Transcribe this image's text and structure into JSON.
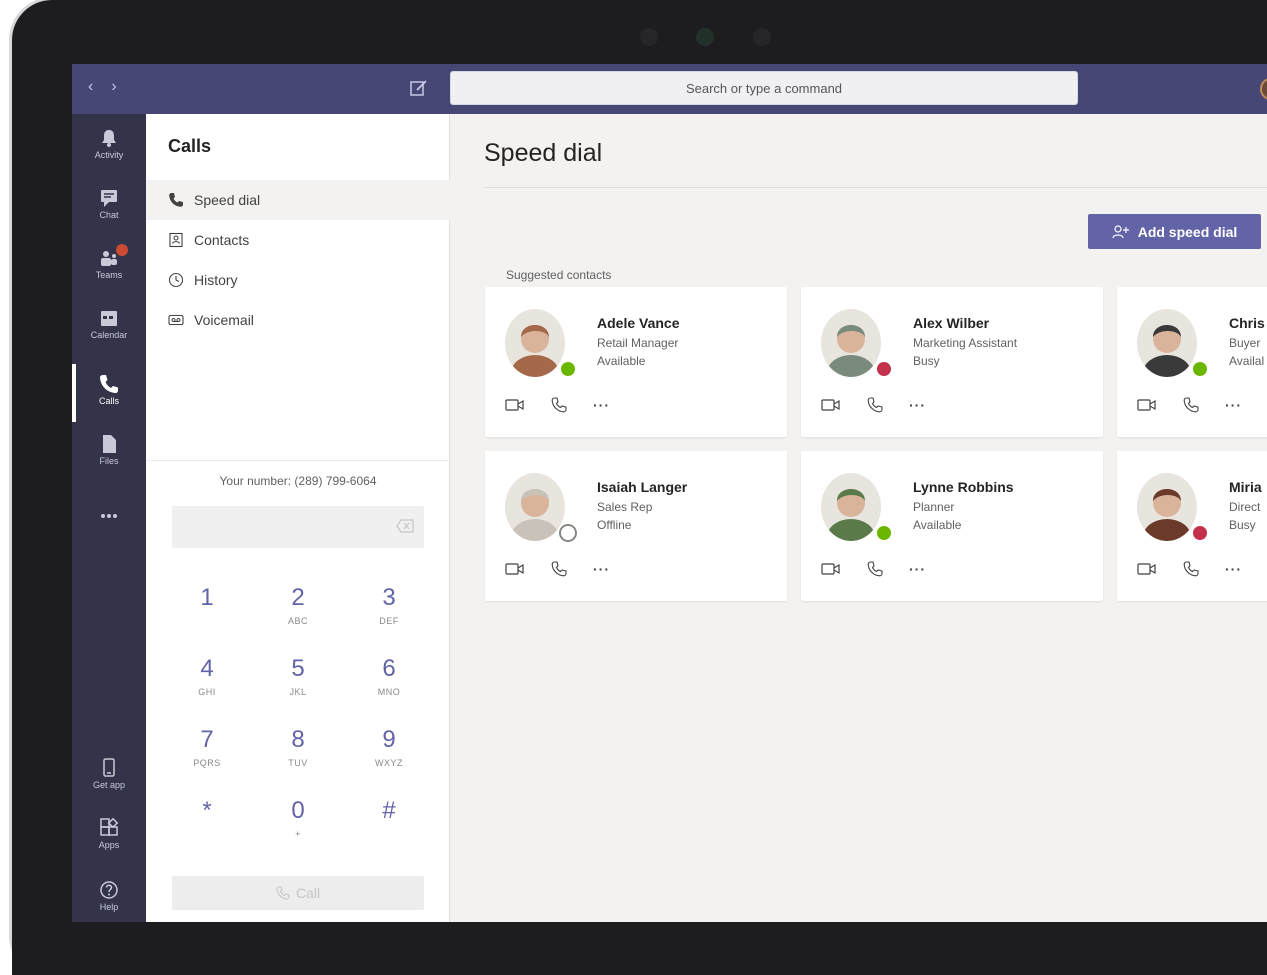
{
  "search": {
    "placeholder": "Search or type a command"
  },
  "rail": {
    "items": [
      {
        "label": "Activity",
        "icon": "bell-icon"
      },
      {
        "label": "Chat",
        "icon": "chat-icon"
      },
      {
        "label": "Teams",
        "icon": "teams-icon"
      },
      {
        "label": "Calendar",
        "icon": "calendar-icon"
      },
      {
        "label": "Calls",
        "icon": "phone-icon",
        "active": true
      },
      {
        "label": "Files",
        "icon": "file-icon"
      },
      {
        "label": "...",
        "icon": "more-icon"
      }
    ],
    "bottom_items": [
      {
        "label": "Get app",
        "icon": "device-icon"
      },
      {
        "label": "Apps",
        "icon": "apps-icon"
      },
      {
        "label": "Help",
        "icon": "help-icon"
      }
    ]
  },
  "calls_panel": {
    "title": "Calls",
    "nav": [
      {
        "label": "Speed dial",
        "icon": "phone-icon",
        "active": true
      },
      {
        "label": "Contacts",
        "icon": "contacts-icon"
      },
      {
        "label": "History",
        "icon": "clock-icon"
      },
      {
        "label": "Voicemail",
        "icon": "voicemail-icon"
      }
    ],
    "your_number": "Your number: (289) 799-6064",
    "keypad": [
      {
        "digit": "1",
        "letters": ""
      },
      {
        "digit": "2",
        "letters": "ABC"
      },
      {
        "digit": "3",
        "letters": "DEF"
      },
      {
        "digit": "4",
        "letters": "GHI"
      },
      {
        "digit": "5",
        "letters": "JKL"
      },
      {
        "digit": "6",
        "letters": "MNO"
      },
      {
        "digit": "7",
        "letters": "PQRS"
      },
      {
        "digit": "8",
        "letters": "TUV"
      },
      {
        "digit": "9",
        "letters": "WXYZ"
      },
      {
        "digit": "*",
        "letters": ""
      },
      {
        "digit": "0",
        "letters": "+"
      },
      {
        "digit": "#",
        "letters": ""
      }
    ],
    "call_label": "Call"
  },
  "main": {
    "title": "Speed dial",
    "add_button": "Add speed dial",
    "suggested_label": "Suggested contacts",
    "contacts": [
      {
        "name": "Adele Vance",
        "role": "Retail Manager",
        "presence": "Available",
        "status": "available",
        "photo_color": "#a5684a"
      },
      {
        "name": "Alex Wilber",
        "role": "Marketing Assistant",
        "presence": "Busy",
        "status": "busy",
        "photo_color": "#7a8a7c"
      },
      {
        "name": "Chris",
        "role": "Buyer",
        "presence": "Availal",
        "status": "available",
        "photo_color": "#3a3a3a"
      },
      {
        "name": "Isaiah Langer",
        "role": "Sales Rep",
        "presence": "Offline",
        "status": "offline",
        "photo_color": "#c9c2b8"
      },
      {
        "name": "Lynne Robbins",
        "role": "Planner",
        "presence": "Available",
        "status": "available",
        "photo_color": "#5a7a4a"
      },
      {
        "name": "Miria",
        "role": "Direct",
        "presence": "Busy",
        "status": "busy",
        "photo_color": "#6b3a2a"
      }
    ]
  }
}
